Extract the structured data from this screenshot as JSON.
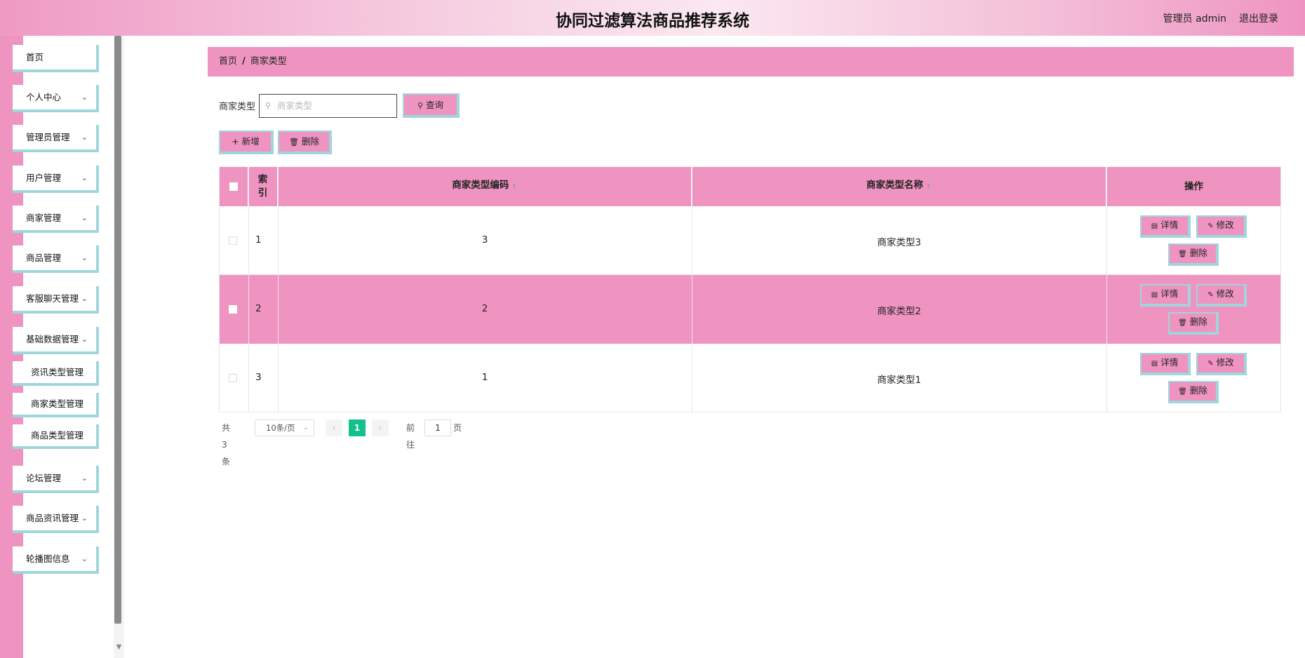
{
  "header": {
    "title": "协同过滤算法商品推荐系统",
    "user": "管理员 admin",
    "logout": "退出登录"
  },
  "sidebar": {
    "items": [
      {
        "label": "首页"
      },
      {
        "label": "个人中心"
      },
      {
        "label": "管理员管理"
      },
      {
        "label": "用户管理"
      },
      {
        "label": "商家管理"
      },
      {
        "label": "商品管理"
      },
      {
        "label": "客服聊天管理"
      },
      {
        "label": "基础数据管理"
      },
      {
        "label": "资讯类型管理"
      },
      {
        "label": "商家类型管理"
      },
      {
        "label": "商品类型管理"
      },
      {
        "label": "论坛管理"
      },
      {
        "label": "商品资讯管理"
      },
      {
        "label": "轮播图信息"
      }
    ]
  },
  "breadcrumb": {
    "home": "首页",
    "separator": "/",
    "current": "商家类型"
  },
  "search": {
    "label": "商家类型",
    "placeholder": "商家类型",
    "query_button": "查询"
  },
  "actions": {
    "add": "新增",
    "delete": "删除"
  },
  "table": {
    "headers": {
      "index": "索引",
      "code": "商家类型编码",
      "name": "商家类型名称",
      "ops": "操作"
    },
    "rows": [
      {
        "index": "1",
        "code": "3",
        "name": "商家类型3"
      },
      {
        "index": "2",
        "code": "2",
        "name": "商家类型2"
      },
      {
        "index": "3",
        "code": "1",
        "name": "商家类型1"
      }
    ],
    "op_labels": {
      "detail": "详情",
      "edit": "修改",
      "delete": "删除"
    }
  },
  "pagination": {
    "total": "共 3 条",
    "page_size": "10条/页",
    "current_page": "1",
    "goto_label": "前往",
    "goto_value": "1",
    "page_suffix": "页"
  },
  "colors": {
    "accent_pink": "#ef94c1",
    "border_cyan": "#9fd6dc",
    "active_page": "#13c08e"
  }
}
